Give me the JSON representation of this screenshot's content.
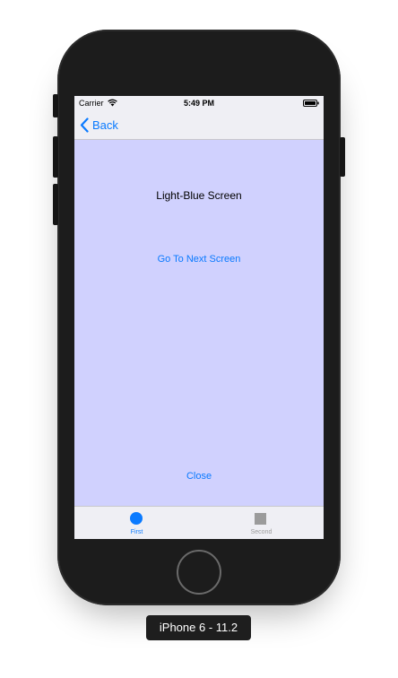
{
  "status_bar": {
    "carrier": "Carrier",
    "time": "5:49 PM",
    "wifi_icon": "wifi-icon",
    "battery_icon": "battery-icon"
  },
  "nav_bar": {
    "back_label": "Back",
    "back_icon": "chevron-left-icon"
  },
  "content": {
    "title": "Light-Blue Screen",
    "next_button": "Go To Next Screen",
    "close_button": "Close",
    "background_color": "#d0d1fe"
  },
  "tab_bar": {
    "tabs": [
      {
        "label": "First",
        "icon": "circle-icon",
        "selected": true
      },
      {
        "label": "Second",
        "icon": "square-icon",
        "selected": false
      }
    ]
  },
  "device": {
    "label": "iPhone 6 - 11.2"
  },
  "colors": {
    "accent": "#0a7aff",
    "inactive": "#9b9b9b",
    "bar_background": "#efeff4",
    "device_body": "#1c1c1c"
  }
}
